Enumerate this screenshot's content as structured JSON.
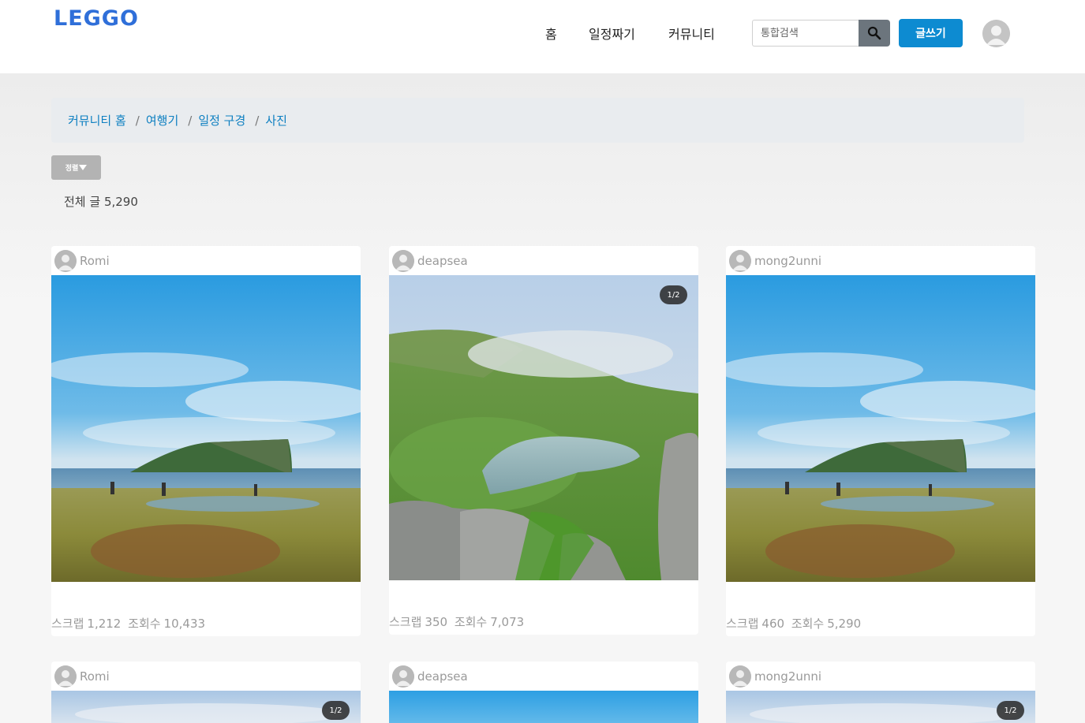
{
  "header": {
    "logo": "LEGGO",
    "nav": [
      {
        "label": "홈"
      },
      {
        "label": "일정짜기"
      },
      {
        "label": "커뮤니티"
      }
    ],
    "search": {
      "placeholder": "통합검색",
      "icon": "search-icon"
    },
    "write_label": "글쓰기",
    "avatar_icon": "user-icon"
  },
  "breadcrumb": [
    "커뮤니티 홈",
    "여행기",
    "일정 구경",
    "사진"
  ],
  "breadcrumb_separator": "/",
  "sort": {
    "label": "정렬",
    "icon": "caret-down-icon"
  },
  "total": {
    "label": "전체 글",
    "count": "5,290"
  },
  "stat_labels": {
    "scrap": "스크랩",
    "views": "조회수"
  },
  "posts": [
    {
      "user": "Romi",
      "scrap": "1,212",
      "views": "10,433",
      "badge": "",
      "photo": "jeju-coast"
    },
    {
      "user": "deapsea",
      "scrap": "350",
      "views": "7,073",
      "badge": "1/2",
      "photo": "crater-lake"
    },
    {
      "user": "mong2unni",
      "scrap": "460",
      "views": "5,290",
      "badge": "",
      "photo": "jeju-coast"
    },
    {
      "user": "Romi",
      "badge": "1/2",
      "photo": "cloudy-sky"
    },
    {
      "user": "deapsea",
      "badge": "",
      "photo": "blue-sky"
    },
    {
      "user": "mong2unni",
      "badge": "1/2",
      "photo": "cloudy-sky"
    }
  ],
  "colors": {
    "brand": "#2f6fd9",
    "write_button": "#0d8bd1",
    "breadcrumb_link": "#0d7fc1",
    "search_button": "#6c757d"
  }
}
